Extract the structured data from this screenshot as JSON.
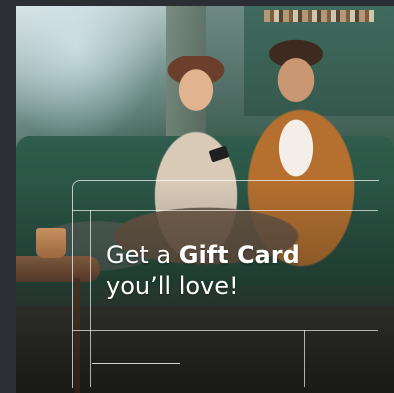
{
  "promo": {
    "headline": {
      "line1_prefix": "Get a",
      "line1_emphasis": "Gift Card",
      "line2": "you’ll love!"
    }
  }
}
